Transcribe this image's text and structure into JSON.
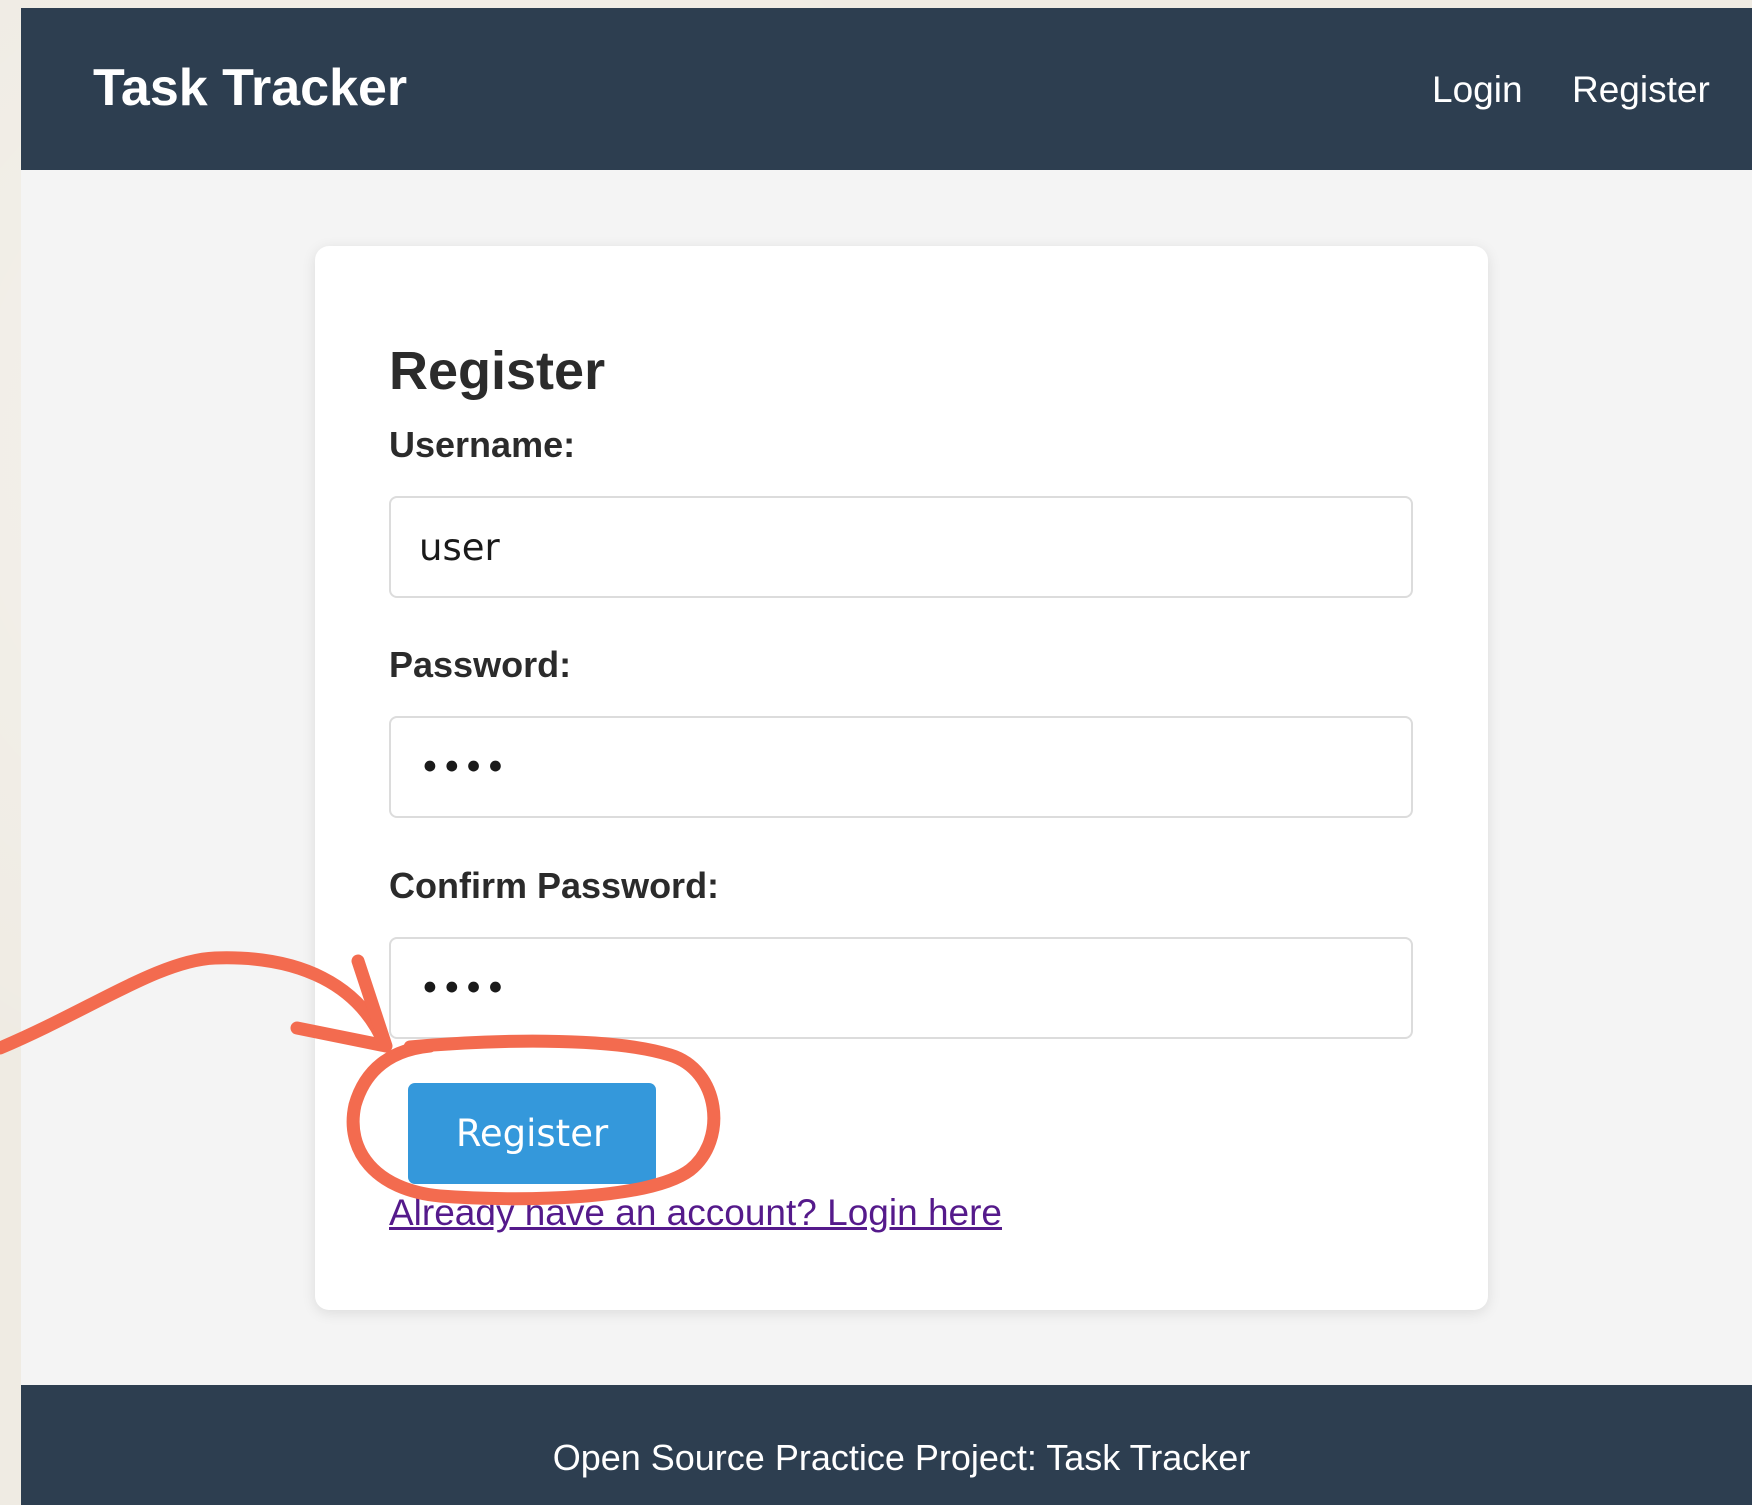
{
  "app": {
    "title": "Task Tracker"
  },
  "nav": {
    "login": "Login",
    "register": "Register"
  },
  "form": {
    "title": "Register",
    "username_label": "Username:",
    "username_value": "user",
    "password_label": "Password:",
    "password_value": "••••",
    "confirm_label": "Confirm Password:",
    "confirm_value": "••••",
    "submit": "Register",
    "login_link": "Already have an account? Login here"
  },
  "footer": {
    "text": "Open Source Practice Project: Task Tracker"
  },
  "colors": {
    "header_bg": "#2d3e50",
    "button_bg": "#3498db",
    "annotation": "#f36b4f",
    "link": "#551a8b"
  }
}
